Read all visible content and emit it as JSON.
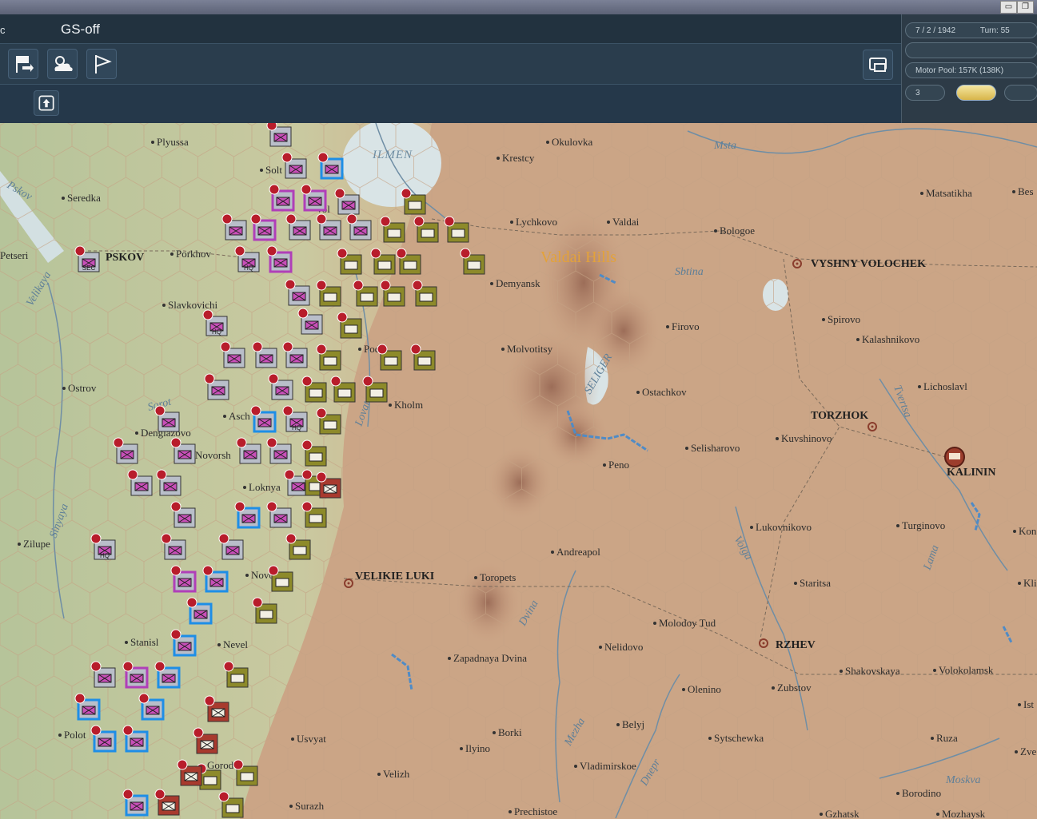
{
  "window": {
    "minimize": "▭",
    "restore": "❐"
  },
  "header": {
    "mode": "GS-off",
    "edge_char": "c"
  },
  "toolbar": [
    {
      "name": "end-turn-icon"
    },
    {
      "name": "weather-icon"
    },
    {
      "name": "flag-icon"
    }
  ],
  "panel": {
    "date": "7 / 2 / 1942",
    "turn": "Turn: 55",
    "motor_pool": "Motor Pool:  157K (138K)",
    "field": "3"
  },
  "map": {
    "places": [
      "Plyussa",
      "Okulovka",
      "Msta",
      "Krestcy",
      "Seredka",
      "Matsatikha",
      "Bes",
      "Lychkovo",
      "Valdai",
      "Bologoe",
      "Petseri",
      "PSKOV",
      "Porkhov",
      "Valdai Hills",
      "VYSHNY VOLOCHEK",
      "Demyansk",
      "Sbtina",
      "Slavkovichi",
      "Firovo",
      "Spirovo",
      "Kalashnikovo",
      "Molvotitsy",
      "Ostrov",
      "Ostachkov",
      "Lichoslavl",
      "Kholm",
      "TORZHOK",
      "Kuvshinovo",
      "Dengiazovo",
      "Novorsh",
      "Selisharovo",
      "Peno",
      "KALININ",
      "Loknya",
      "Lukovnikovo",
      "Turginovo",
      "Zilupe",
      "Andreapol",
      "VELIKIE LUKI",
      "Toropets",
      "Staritsa",
      "Molodoy Tud",
      "Nelidovo",
      "RZHEV",
      "Zapadnaya Dvina",
      "Olenino",
      "Zubstov",
      "Shakovskaya",
      "Volokolamsk",
      "Usvyat",
      "Borki",
      "Belyj",
      "Ilyino",
      "Sytschewka",
      "Ruza",
      "Velizh",
      "Vladimirskoe",
      "Surazh",
      "Prechistoe",
      "Borodino",
      "Gzhatsk",
      "Mozhaysk",
      "Polot",
      "Gorod",
      "Stanisl",
      "Nevel",
      "Asch",
      "Solt",
      "Vol",
      "Pod",
      "Novo",
      "Kon",
      "Kli",
      "Ist",
      "Zve"
    ],
    "waters": [
      "ILMEN",
      "Pskov",
      "Velikaya",
      "Sorot",
      "Sinyaya",
      "SELIGER",
      "Volga",
      "Tvertsa",
      "Lama",
      "Dvina",
      "Mezha",
      "Dnepr",
      "Moskva",
      "Lovat"
    ],
    "units": [
      {
        "label": "HQ",
        "num": "1"
      },
      {
        "label": "SEC",
        "num": "1"
      },
      {
        "label": "HQ",
        "num": "2"
      },
      {
        "label": "HQ",
        "num": "1"
      },
      {
        "label": "HQ",
        "num": "2"
      }
    ]
  },
  "colors": {
    "german_unit": "#b9bec9",
    "german_border": "#b03fb8",
    "selected": "#1e8ee6",
    "soviet_unit": "#8d8a2a",
    "soviet_red": "#a83a2e"
  }
}
